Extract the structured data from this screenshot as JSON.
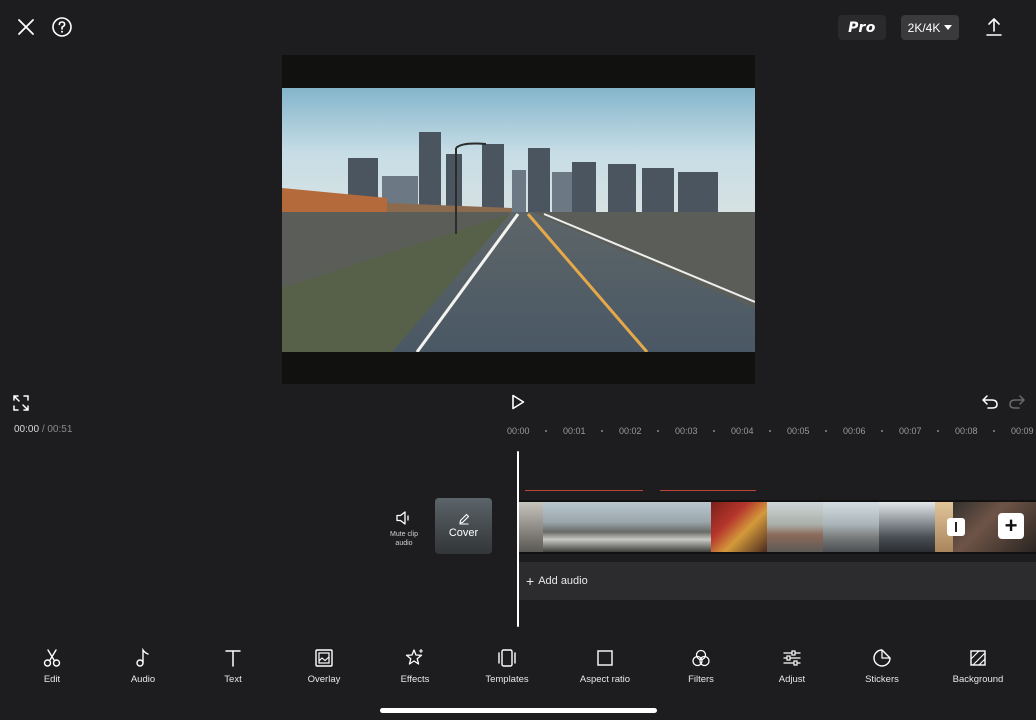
{
  "topbar": {
    "pro_label": "Pro",
    "resolution_label": "2K/4K",
    "icons": [
      "close-icon",
      "help-icon",
      "export-icon"
    ]
  },
  "player": {
    "current_time": "00:00",
    "separator": "/",
    "total_time": "00:51",
    "icons": [
      "fullscreen-icon",
      "play-icon",
      "undo-icon",
      "redo-icon"
    ]
  },
  "timeline": {
    "ruler": [
      "00:00",
      "00:01",
      "00:02",
      "00:03",
      "00:04",
      "00:05",
      "00:06",
      "00:07",
      "00:08",
      "00:09"
    ],
    "mute_label": "Mute clip audio",
    "cover_label": "Cover",
    "add_audio_label": "Add audio"
  },
  "toolbar": {
    "items": [
      {
        "label": "Edit",
        "icon": "scissors-icon"
      },
      {
        "label": "Audio",
        "icon": "music-note-icon"
      },
      {
        "label": "Text",
        "icon": "text-icon"
      },
      {
        "label": "Overlay",
        "icon": "overlay-icon"
      },
      {
        "label": "Effects",
        "icon": "effects-star-icon"
      },
      {
        "label": "Templates",
        "icon": "templates-icon"
      },
      {
        "label": "Aspect ratio",
        "icon": "aspect-ratio-icon"
      },
      {
        "label": "Filters",
        "icon": "filters-icon"
      },
      {
        "label": "Adjust",
        "icon": "adjust-sliders-icon"
      },
      {
        "label": "Stickers",
        "icon": "stickers-icon"
      },
      {
        "label": "Background",
        "icon": "background-icon"
      }
    ]
  },
  "colors": {
    "background": "#1d1d1f",
    "preview_frame": "#11120f",
    "audio_track": "#2c2c2e",
    "accent_red": "#c0433c"
  }
}
